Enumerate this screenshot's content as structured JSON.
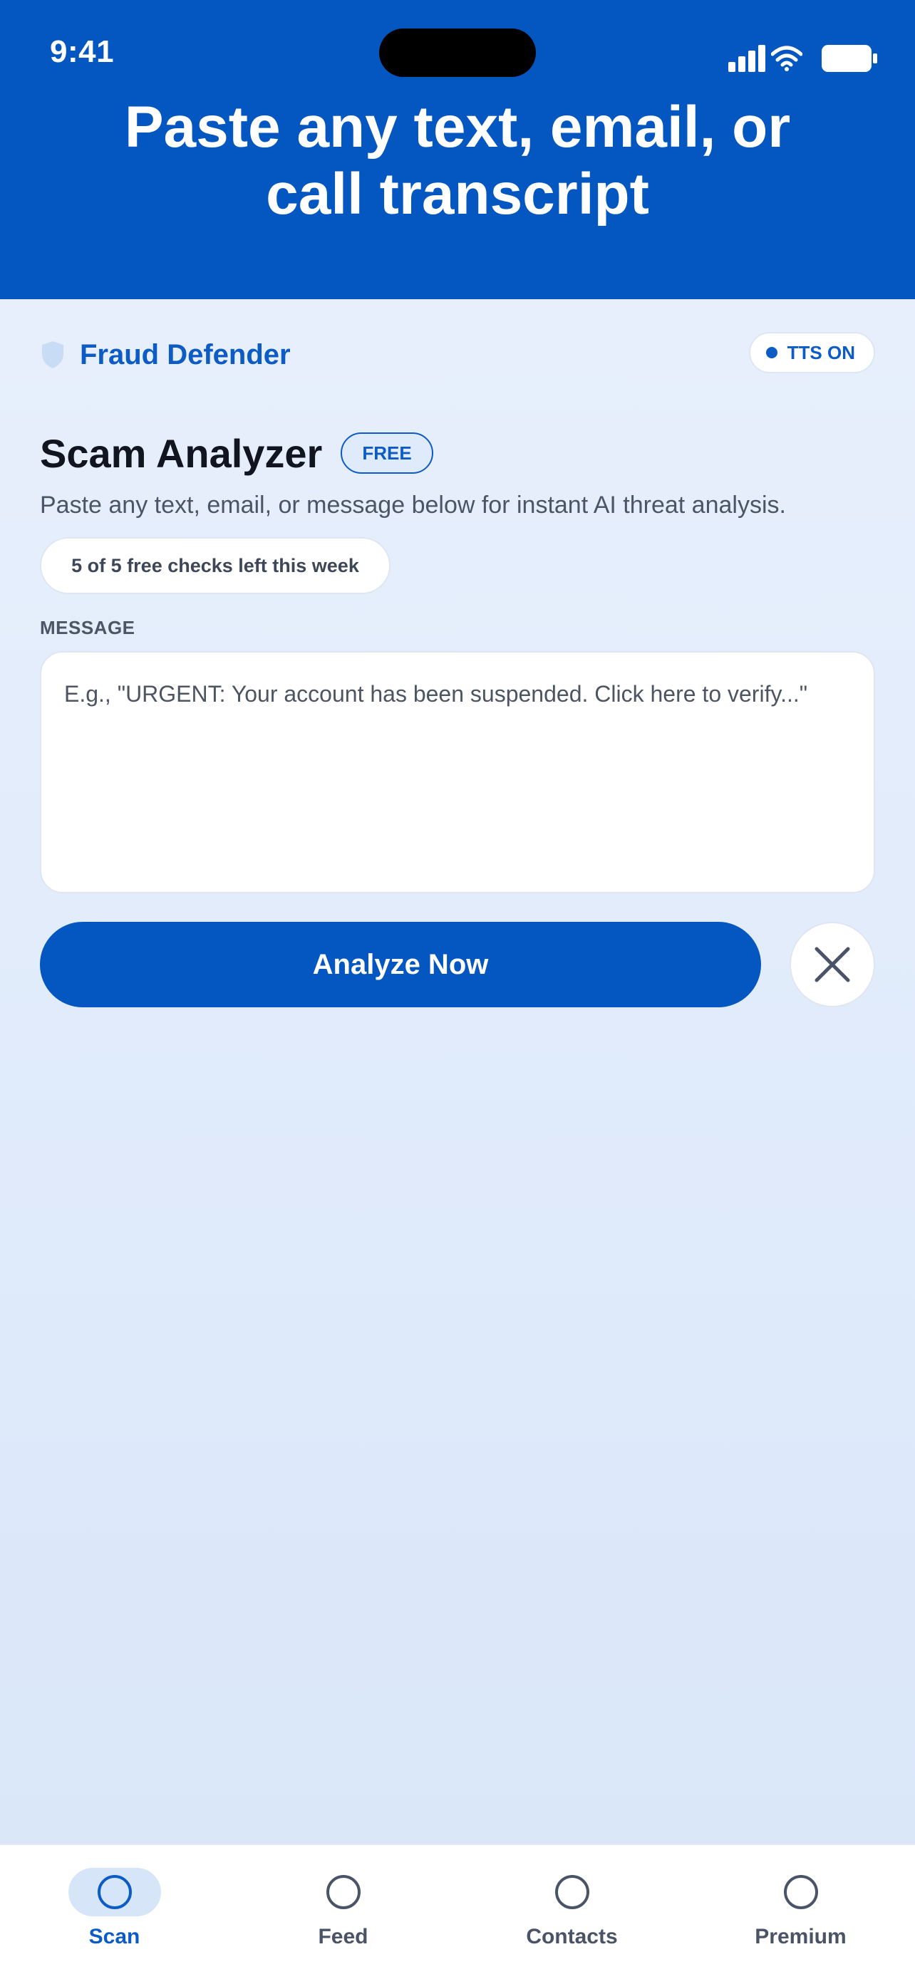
{
  "status_bar": {
    "time": "9:41"
  },
  "header": {
    "title": "Paste any text, email, or call transcript"
  },
  "brand": {
    "name": "Fraud Defender",
    "tts_label": "TTS ON"
  },
  "analyzer": {
    "title": "Scam Analyzer",
    "badge": "FREE",
    "subtitle": "Paste any text, email, or message below for instant AI threat analysis.",
    "checks_left": "5 of 5 free checks left this week",
    "message_label": "MESSAGE",
    "message_value": "",
    "message_placeholder": "E.g., \"URGENT: Your account has been suspended. Click here to verify...\"",
    "analyze_label": "Analyze Now"
  },
  "nav": {
    "items": [
      {
        "label": "Scan",
        "active": true
      },
      {
        "label": "Feed",
        "active": false
      },
      {
        "label": "Contacts",
        "active": false
      },
      {
        "label": "Premium",
        "active": false
      }
    ]
  },
  "colors": {
    "primary": "#0456c1",
    "accent_text": "#0d5bc5",
    "background": "#eaf1fc"
  }
}
